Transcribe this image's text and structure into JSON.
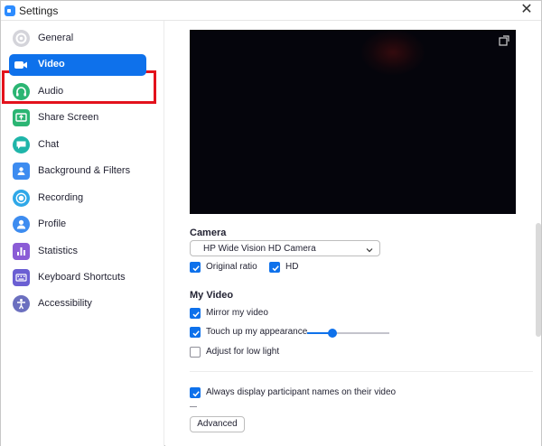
{
  "window": {
    "title": "Settings",
    "close_glyph": "✕"
  },
  "sidebar": {
    "items": [
      {
        "key": "general",
        "label": "General",
        "icon": "gear-icon",
        "color": "#c9c9cf"
      },
      {
        "key": "video",
        "label": "Video",
        "icon": "video-camera-icon",
        "color": "#ffffff",
        "active": true
      },
      {
        "key": "audio",
        "label": "Audio",
        "icon": "headphones-icon",
        "color": "#2bb573"
      },
      {
        "key": "share-screen",
        "label": "Share Screen",
        "icon": "share-screen-icon",
        "color": "#2bb573"
      },
      {
        "key": "chat",
        "label": "Chat",
        "icon": "chat-bubble-icon",
        "color": "#1fb5a9"
      },
      {
        "key": "background-filters",
        "label": "Background & Filters",
        "icon": "person-background-icon",
        "color": "#3d8cf0"
      },
      {
        "key": "recording",
        "label": "Recording",
        "icon": "record-icon",
        "color": "#2fa8e8"
      },
      {
        "key": "profile",
        "label": "Profile",
        "icon": "profile-icon",
        "color": "#3d8cf0"
      },
      {
        "key": "statistics",
        "label": "Statistics",
        "icon": "bar-chart-icon",
        "color": "#8b5cd6"
      },
      {
        "key": "keyboard-shortcuts",
        "label": "Keyboard Shortcuts",
        "icon": "keyboard-icon",
        "color": "#6b5fd3"
      },
      {
        "key": "accessibility",
        "label": "Accessibility",
        "icon": "accessibility-icon",
        "color": "#6b6fbf"
      }
    ]
  },
  "main": {
    "camera": {
      "heading": "Camera",
      "selected": "HP Wide Vision HD Camera",
      "original_ratio": {
        "label": "Original ratio",
        "checked": true
      },
      "hd": {
        "label": "HD",
        "checked": true
      }
    },
    "my_video": {
      "heading": "My Video",
      "mirror": {
        "label": "Mirror my video",
        "checked": true
      },
      "touch_up": {
        "label": "Touch up my appearance",
        "checked": true,
        "slider_value": 0.28
      },
      "low_light": {
        "label": "Adjust for low light",
        "checked": false
      }
    },
    "participant_names": {
      "label": "Always display participant names on their video",
      "checked": true
    },
    "advanced_button": "Advanced"
  },
  "colors": {
    "accent": "#0e71eb",
    "highlight_border": "#e3121c"
  }
}
